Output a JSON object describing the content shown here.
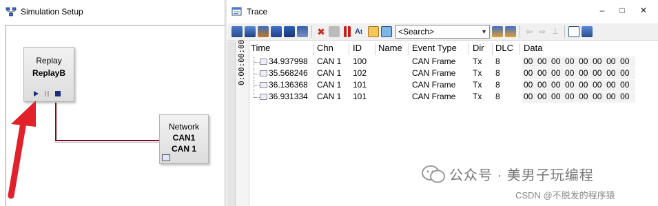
{
  "simulation": {
    "title": "Simulation Setup",
    "replay_node": {
      "label": "Replay",
      "name": "ReplayB"
    },
    "network_node": {
      "label": "Network",
      "name": "CAN1",
      "channel": "CAN 1"
    }
  },
  "trace": {
    "title": "Trace",
    "window_controls": {
      "minimize": "–",
      "maximize": "□",
      "close": "✕"
    },
    "search": {
      "placeholder": "<Search>"
    },
    "time_display": "0:00:00:00",
    "columns": [
      "Time",
      "Chn",
      "ID",
      "Name",
      "Event Type",
      "Dir",
      "DLC",
      "Data"
    ],
    "rows": [
      {
        "time": "34.937998",
        "chn": "CAN 1",
        "id": "100",
        "name": "",
        "event_type": "CAN Frame",
        "dir": "Tx",
        "dlc": "8",
        "data": "00  00  00  00  00  00  00  00"
      },
      {
        "time": "35.568246",
        "chn": "CAN 1",
        "id": "102",
        "name": "",
        "event_type": "CAN Frame",
        "dir": "Tx",
        "dlc": "8",
        "data": "00  00  00  00  00  00  00  00"
      },
      {
        "time": "36.136368",
        "chn": "CAN 1",
        "id": "101",
        "name": "",
        "event_type": "CAN Frame",
        "dir": "Tx",
        "dlc": "8",
        "data": "00  00  00  00  00  00  00  00"
      },
      {
        "time": "36.931334",
        "chn": "CAN 1",
        "id": "101",
        "name": "",
        "event_type": "CAN Frame",
        "dir": "Tx",
        "dlc": "8",
        "data": "00  00  00  00  00  00  00  00"
      }
    ]
  },
  "watermark": {
    "text": "公众号 · 美男子玩编程",
    "credit": "CSDN @不脱发的程序猿"
  },
  "colors": {
    "arrow": "#e2222a",
    "connection": "#7a0c1e",
    "play": "#1b2d7a"
  }
}
